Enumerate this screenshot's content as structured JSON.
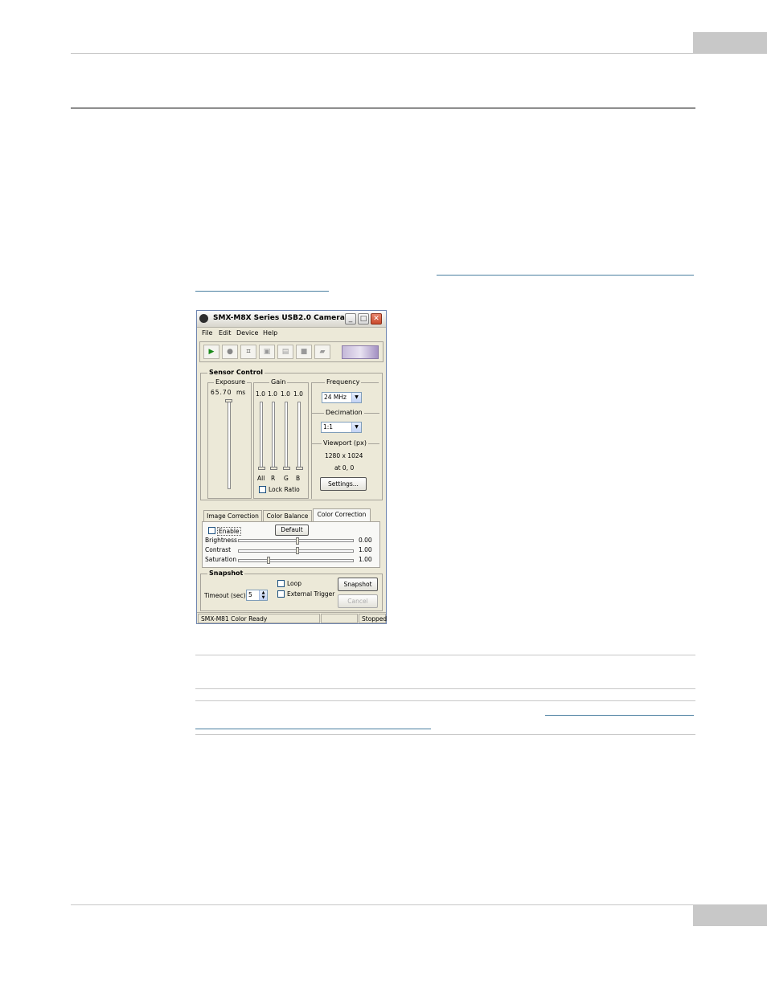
{
  "window": {
    "title": "SMX-M8X Series USB2.0 Camera",
    "controls": {
      "minimize": "_",
      "maximize": "□",
      "close": "✕"
    }
  },
  "menu": [
    "File",
    "Edit",
    "Device",
    "Help"
  ],
  "toolbar": {
    "icons": [
      "play-icon",
      "stop-icon",
      "crop-icon",
      "capture-icon",
      "multi-capture-icon",
      "record-icon",
      "video-icon"
    ]
  },
  "sensor_control": {
    "title": "Sensor Control",
    "exposure": {
      "label": "Exposure",
      "value": "65.70",
      "unit": "ms",
      "level": 0.95
    },
    "gain": {
      "label": "Gain",
      "values": [
        "1.0",
        "1.0",
        "1.0",
        "1.0"
      ],
      "channels": [
        "All",
        "R",
        "G",
        "B"
      ],
      "lock_ratio": "Lock Ratio"
    },
    "frequency": {
      "label": "Frequency",
      "value": "24 MHz"
    },
    "decimation": {
      "label": "Decimation",
      "value": "1:1"
    },
    "viewport": {
      "label": "Viewport (px)",
      "size": "1280 x 1024",
      "position": "at 0, 0",
      "settings_button": "Settings..."
    }
  },
  "tabs": [
    "Image Correction",
    "Color Balance",
    "Color Correction"
  ],
  "color_correction": {
    "enable": "Enable",
    "default_button": "Default",
    "sliders": [
      {
        "label": "Brightness",
        "value": "0.00",
        "level": 0.5
      },
      {
        "label": "Contrast",
        "value": "1.00",
        "level": 0.5
      },
      {
        "label": "Saturation",
        "value": "1.00",
        "level": 0.25
      }
    ]
  },
  "snapshot": {
    "title": "Snapshot",
    "loop": "Loop",
    "external_trigger": "External Trigger",
    "timeout_label": "Timeout (sec)",
    "timeout_value": "5",
    "snapshot_button": "Snapshot",
    "cancel_button": "Cancel"
  },
  "statusbar": {
    "left": "SMX-M81 Color Ready",
    "right": "Stopped"
  }
}
